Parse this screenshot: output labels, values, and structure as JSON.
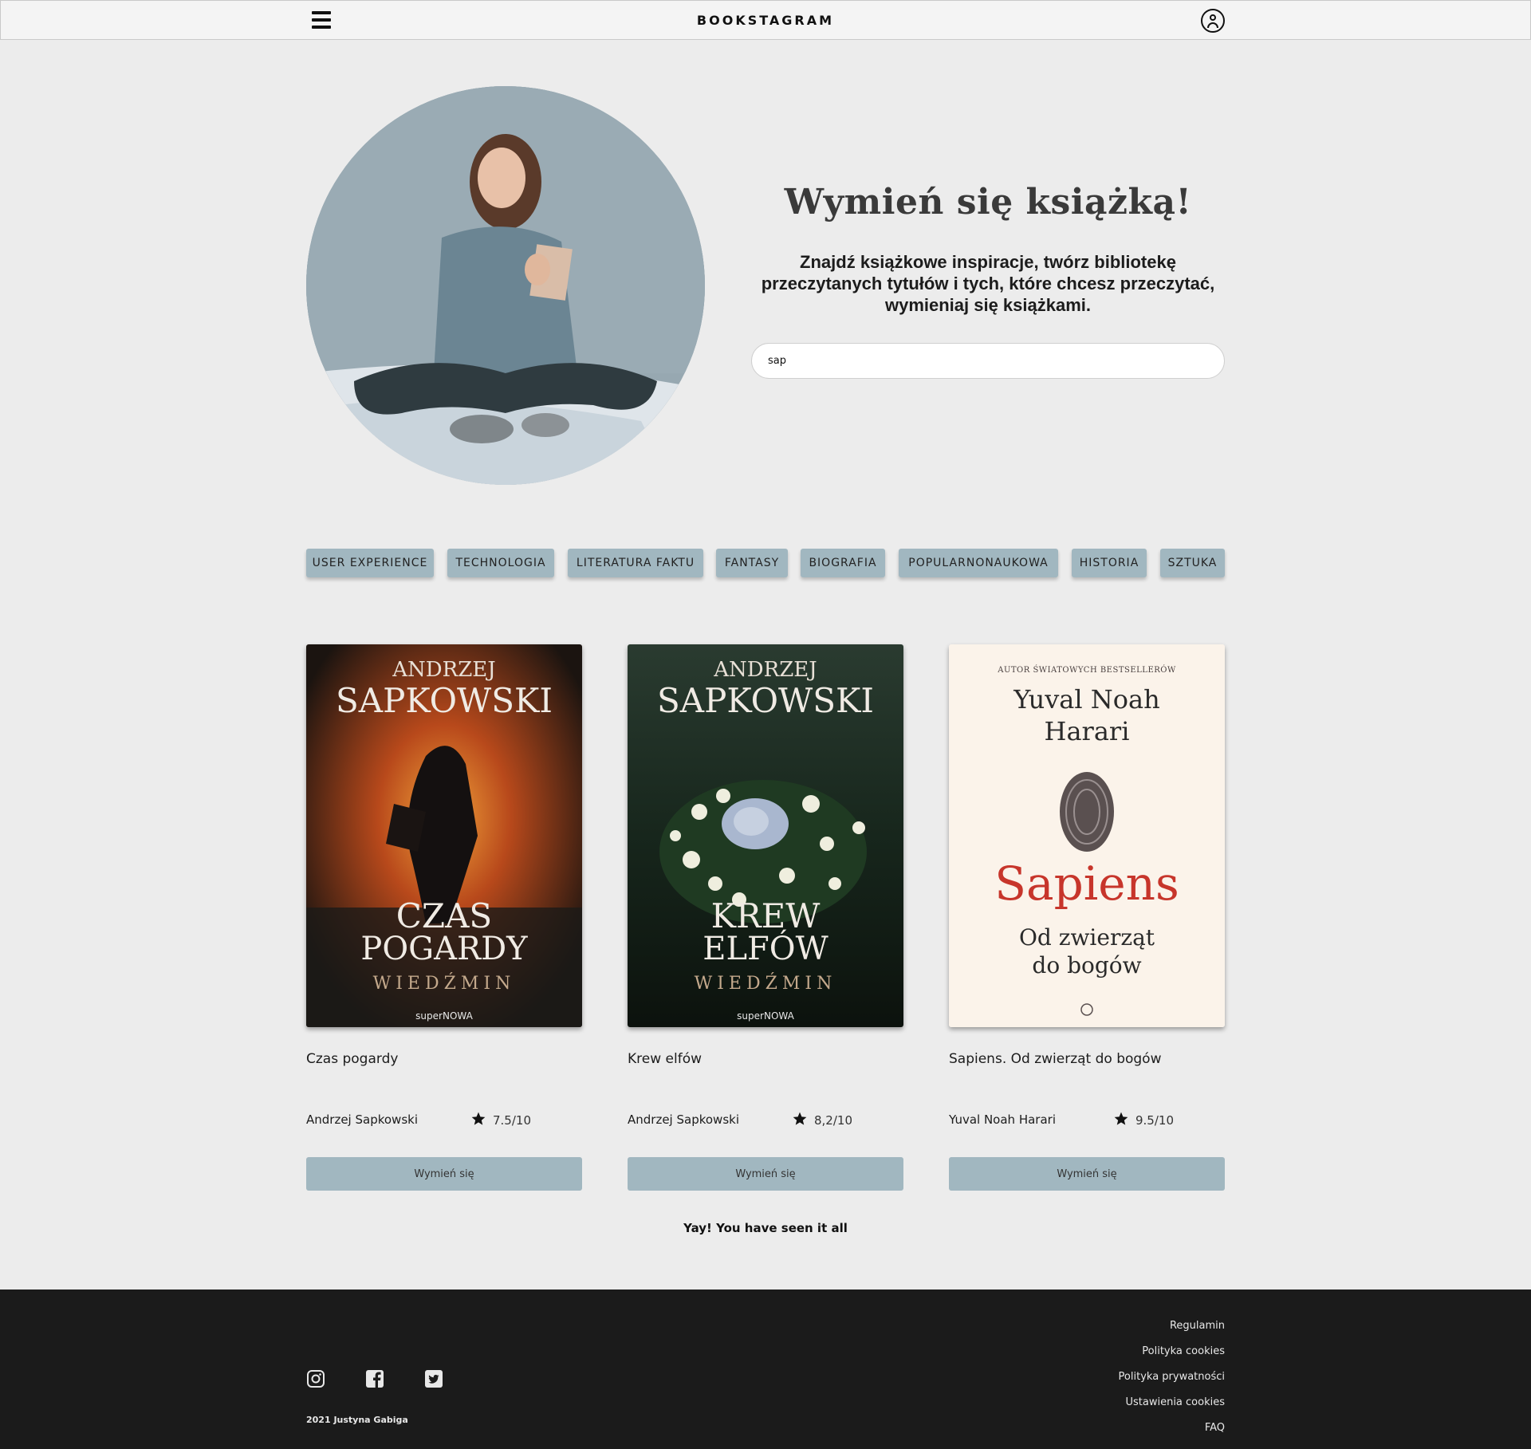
{
  "header": {
    "brand": "BOOKSTAGRAM",
    "menu_icon": "hamburger-menu-icon",
    "user_icon": "user-account-icon"
  },
  "hero": {
    "title": "Wymień się książką!",
    "subtitle": "Znajdź książkowe inspiracje, twórz bibliotekę przeczytanych tytułów i tych, które chcesz przeczytać, wymieniaj się książkami.",
    "search_value": "sap"
  },
  "categories": [
    "USER EXPERIENCE",
    "TECHNOLOGIA",
    "LITERATURA FAKTU",
    "FANTASY",
    "BIOGRAFIA",
    "POPULARNONAUKOWA",
    "HISTORIA",
    "SZTUKA"
  ],
  "books": [
    {
      "title": "Czas pogardy",
      "author": "Andrzej Sapkowski",
      "rating": "7.5/10",
      "button": "Wymień się",
      "cover": {
        "author_line1": "ANDRZEJ",
        "author_line2": "SAPKOWSKI",
        "title_line1": "CZAS",
        "title_line2": "POGARDY",
        "series": "WIEDŹMIN",
        "publisher": "superNOWA"
      }
    },
    {
      "title": "Krew elfów",
      "author": "Andrzej Sapkowski",
      "rating": "8,2/10",
      "button": "Wymień się",
      "cover": {
        "author_line1": "ANDRZEJ",
        "author_line2": "SAPKOWSKI",
        "title_line1": "KREW",
        "title_line2": "ELFÓW",
        "series": "WIEDŹMIN",
        "publisher": "superNOWA"
      }
    },
    {
      "title": "Sapiens. Od zwierząt do bogów",
      "author": "Yuval Noah Harari",
      "rating": "9.5/10",
      "button": "Wymień się",
      "cover": {
        "tagline": "AUTOR ŚWIATOWYCH BESTSELLERÓW",
        "author_line1": "Yuval Noah",
        "author_line2": "Harari",
        "title": "Sapiens",
        "subtitle_line1": "Od zwierząt",
        "subtitle_line2": "do bogów"
      }
    }
  ],
  "end_message": "Yay! You have seen it all",
  "footer": {
    "links": [
      "Regulamin",
      "Polityka cookies",
      "Polityka prywatności",
      "Ustawienia cookies",
      "FAQ"
    ],
    "social_icons": [
      "instagram-icon",
      "facebook-icon",
      "twitter-icon"
    ],
    "copyright": "2021 Justyna Gabiga"
  },
  "colors": {
    "background": "#ececec",
    "accent": "#a1b7c0",
    "footer": "#1b1b1b",
    "sapiens_red": "#c7352b"
  }
}
